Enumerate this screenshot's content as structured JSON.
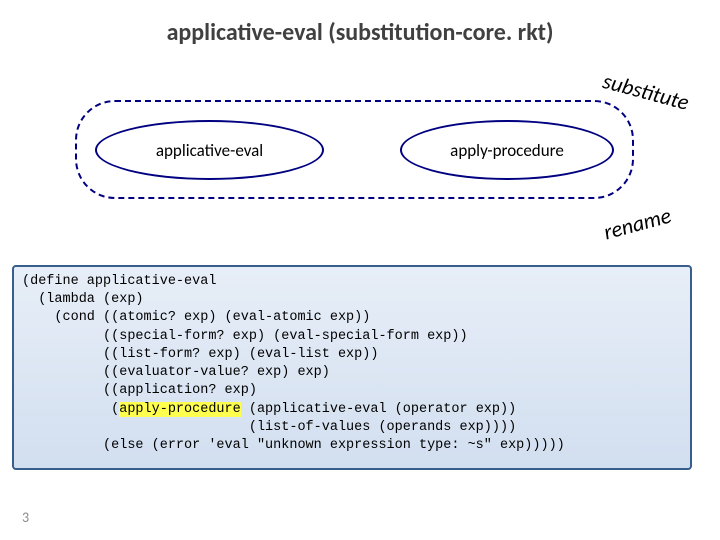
{
  "title": "applicative-eval (substitution-core. rkt)",
  "diagram": {
    "left_label": "applicative-eval",
    "right_label": "apply-procedure"
  },
  "annotations": {
    "substitute": "substitute",
    "rename": "rename"
  },
  "code": {
    "l1": "(define applicative-eval",
    "l2": "  (lambda (exp)",
    "l3": "    (cond ((atomic? exp) (eval-atomic exp))",
    "l4": "          ((special-form? exp) (eval-special-form exp))",
    "l5": "          ((list-form? exp) (eval-list exp))",
    "l6": "          ((evaluator-value? exp) exp)",
    "l7": "          ((application? exp)",
    "l8a": "           (",
    "l8h": "apply-procedure",
    "l8b": " (applicative-eval (operator exp))",
    "l9": "                            (list-of-values (operands exp))))",
    "l10": "          (else (error 'eval \"unknown expression type: ~s\" exp)))))"
  },
  "page_number": "3",
  "chart_data": {
    "type": "diagram",
    "title": "applicative-eval (substitution-core.rkt)",
    "container": "dashed rounded box",
    "nodes": [
      {
        "id": "applicative-eval",
        "shape": "ellipse"
      },
      {
        "id": "apply-procedure",
        "shape": "ellipse"
      }
    ],
    "annotations": [
      "substitute",
      "rename"
    ],
    "code_block": "(define applicative-eval\n  (lambda (exp)\n    (cond ((atomic? exp) (eval-atomic exp))\n          ((special-form? exp) (eval-special-form exp))\n          ((list-form? exp) (eval-list exp))\n          ((evaluator-value? exp) exp)\n          ((application? exp)\n           (apply-procedure (applicative-eval (operator exp))\n                            (list-of-values (operands exp))))\n          (else (error 'eval \"unknown expression type: ~s\" exp)))))"
  }
}
